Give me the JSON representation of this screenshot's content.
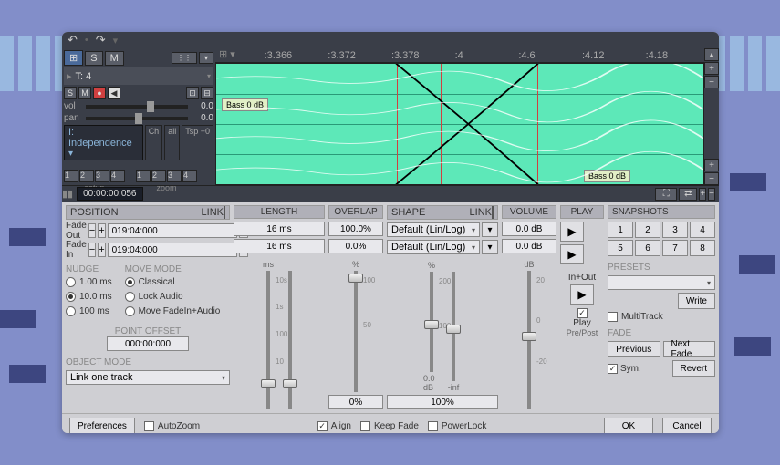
{
  "titlebar": {
    "undo": "↶",
    "redo": "↷"
  },
  "track": {
    "sm1": "S",
    "sm2": "M",
    "name": "T: 4",
    "solo": "S",
    "mute": "M",
    "vol_label": "vol",
    "vol_value": "0.0",
    "pan_label": "pan",
    "pan_value": "0.0",
    "preset": "I: Independence",
    "ch": "Ch",
    "all": "all",
    "tsp": "Tsp +0",
    "setup_label": "setup",
    "zoom_label": "zoom",
    "nums": [
      "1",
      "2",
      "3",
      "4"
    ]
  },
  "ruler": {
    "ticks": [
      ":3.366",
      ":3.372",
      ":3.378",
      ":4",
      ":4.6",
      ":4.12",
      ":4.18"
    ]
  },
  "waveform": {
    "label1": "Bass  0 dB",
    "label2": "Bass  0 dB"
  },
  "timecode": "00:00:00:056",
  "headers": {
    "position": "POSITION",
    "link": "LINK",
    "length": "LENGTH",
    "overlap": "OVERLAP",
    "shape": "SHAPE",
    "volume": "VOLUME",
    "play": "PLAY",
    "snapshots": "SNAPSHOTS"
  },
  "fade": {
    "out_label": "Fade Out",
    "in_label": "Fade In",
    "out_value": "019:04:000",
    "in_value": "019:04:000",
    "minus": "−",
    "plus": "+",
    "star": "✱"
  },
  "nudge": {
    "label": "NUDGE",
    "opt1": "1.00 ms",
    "opt2": "10.0 ms",
    "opt3": "100 ms"
  },
  "movemode": {
    "label": "MOVE MODE",
    "opt1": "Classical",
    "opt2": "Lock Audio",
    "opt3": "Move FadeIn+Audio"
  },
  "pointoffset": {
    "label": "POINT OFFSET",
    "value": "000:00:000"
  },
  "objectmode": {
    "label": "OBJECT MODE",
    "value": "Link one track"
  },
  "length": {
    "val1": "16 ms",
    "val2": "16 ms",
    "unit": "ms",
    "s1": "10s",
    "s2": "1s",
    "s3": "100",
    "s4": "10"
  },
  "overlap": {
    "val1": "100.0%",
    "val2": "0.0%",
    "unit": "%",
    "s1": "100",
    "s2": "50",
    "pct": "0%"
  },
  "shape": {
    "val1": "Default  (Lin/Log)",
    "val2": "Default  (Lin/Log)",
    "unit": "%",
    "s1": "200",
    "s2": "100",
    "db": "0.0 dB",
    "inf": "-inf",
    "pct": "100%"
  },
  "volume": {
    "val1": "0.0 dB",
    "val2": "0.0 dB",
    "unit": "dB",
    "s1": "20",
    "s2": "0",
    "s3": "-20"
  },
  "play": {
    "inout": "In+Out",
    "play_label": "Play",
    "prepost": "Pre/Post",
    "tri": "▶"
  },
  "snapshots": {
    "nums": [
      "1",
      "2",
      "3",
      "4",
      "5",
      "6",
      "7",
      "8"
    ],
    "presets_label": "PRESETS",
    "write": "Write",
    "multitrack": "MultiTrack",
    "fade_label": "FADE",
    "previous": "Previous",
    "next": "Next Fade",
    "sym": "Sym.",
    "revert": "Revert"
  },
  "bottom": {
    "preferences": "Preferences",
    "autozoom": "AutoZoom",
    "align": "Align",
    "keepfade": "Keep Fade",
    "powerlock": "PowerLock",
    "ok": "OK",
    "cancel": "Cancel"
  }
}
